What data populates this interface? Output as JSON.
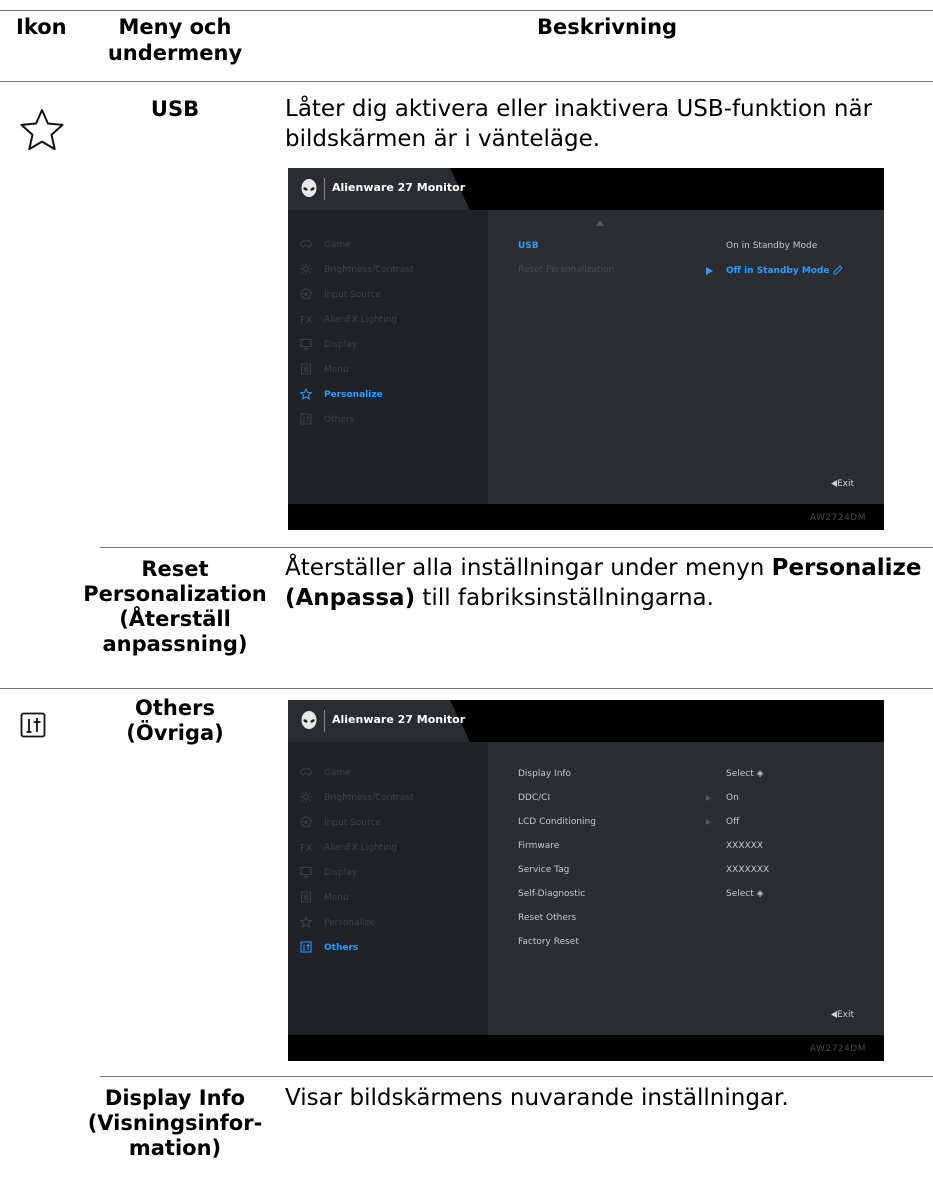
{
  "headers": {
    "icon": "Ikon",
    "menu": "Meny och undermeny",
    "menu_line1": "Meny och",
    "menu_line2": "undermeny",
    "description": "Beskrivning"
  },
  "usb": {
    "icon": "star-icon",
    "title": "USB",
    "desc_line1": "Låter dig aktivera eller inaktivera USB-funktion när",
    "desc_line2": "bildskärmen är i vänteläge."
  },
  "reset_personalization": {
    "title_line1": "Reset",
    "title_line2": "Personalization",
    "title_line3": "(Återställ",
    "title_line4": "anpassning)",
    "desc_pre": "Återställer alla inställningar under menyn ",
    "desc_bold1": "Personalize",
    "desc_bold2": "(Anpassa)",
    "desc_post": " till fabriksinställningarna."
  },
  "others": {
    "icon": "others-icon",
    "title_line1": "Others",
    "title_line2": "(Övriga)"
  },
  "display_info": {
    "title_line1": "Display Info",
    "title_line2": "(Visningsinfor-",
    "title_line3": "mation)",
    "desc": "Visar bildskärmens nuvarande inställningar."
  },
  "osd1": {
    "brand": "Alienware 27 Monitor",
    "model": "AW2724DM",
    "exit": "Exit",
    "menu": [
      "Game",
      "Brightness/Contrast",
      "Input Source",
      "AlienFX Lighting",
      "Display",
      "Menu",
      "Personalize",
      "Others"
    ],
    "active_menu": "Personalize",
    "submenu": [
      "USB",
      "Reset Personalization"
    ],
    "usb_values": [
      "On in Standby Mode",
      "Off in Standby Mode"
    ]
  },
  "osd2": {
    "brand": "Alienware 27 Monitor",
    "model": "AW2724DM",
    "exit": "Exit",
    "menu": [
      "Game",
      "Brightness/Contrast",
      "Input Source",
      "AlienFX Lighting",
      "Display",
      "Menu",
      "Personalize",
      "Others"
    ],
    "active_menu": "Others",
    "items": [
      "Display Info",
      "DDC/CI",
      "LCD Conditioning",
      "Firmware",
      "Service Tag",
      "Self-Diagnostic",
      "Reset Others",
      "Factory Reset"
    ],
    "values": [
      "Select",
      "On",
      "Off",
      "XXXXXX",
      "XXXXXXX",
      "Select"
    ]
  },
  "colors": {
    "accent": "#2d9cff",
    "osd_bg": "#1b1d21",
    "rule": "#777777"
  }
}
